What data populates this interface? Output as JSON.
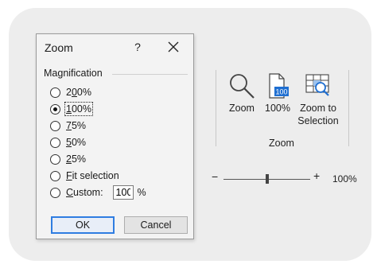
{
  "dialog": {
    "title": "Zoom",
    "help_label": "?",
    "group_label": "Magnification",
    "options": [
      {
        "label": "200%",
        "selected": false
      },
      {
        "label": "100%",
        "selected": true
      },
      {
        "label": "75%",
        "selected": false
      },
      {
        "label": "50%",
        "selected": false
      },
      {
        "label": "25%",
        "selected": false
      },
      {
        "label": "Fit selection",
        "selected": false
      },
      {
        "label": "Custom:",
        "selected": false
      }
    ],
    "custom_value": "100",
    "custom_unit": "%",
    "ok_label": "OK",
    "cancel_label": "Cancel"
  },
  "ribbon": {
    "group_name": "Zoom",
    "zoom_label": "Zoom",
    "hundred_label": "100%",
    "hundred_icon_text": "100",
    "zoom_sel_line1": "Zoom to",
    "zoom_sel_line2": "Selection"
  },
  "statusbar": {
    "minus": "−",
    "plus": "+",
    "zoom_percent": "100%",
    "slider_level": 0.5
  },
  "colors": {
    "accent": "#2f7de1",
    "icon_blue": "#1f6fd1"
  }
}
